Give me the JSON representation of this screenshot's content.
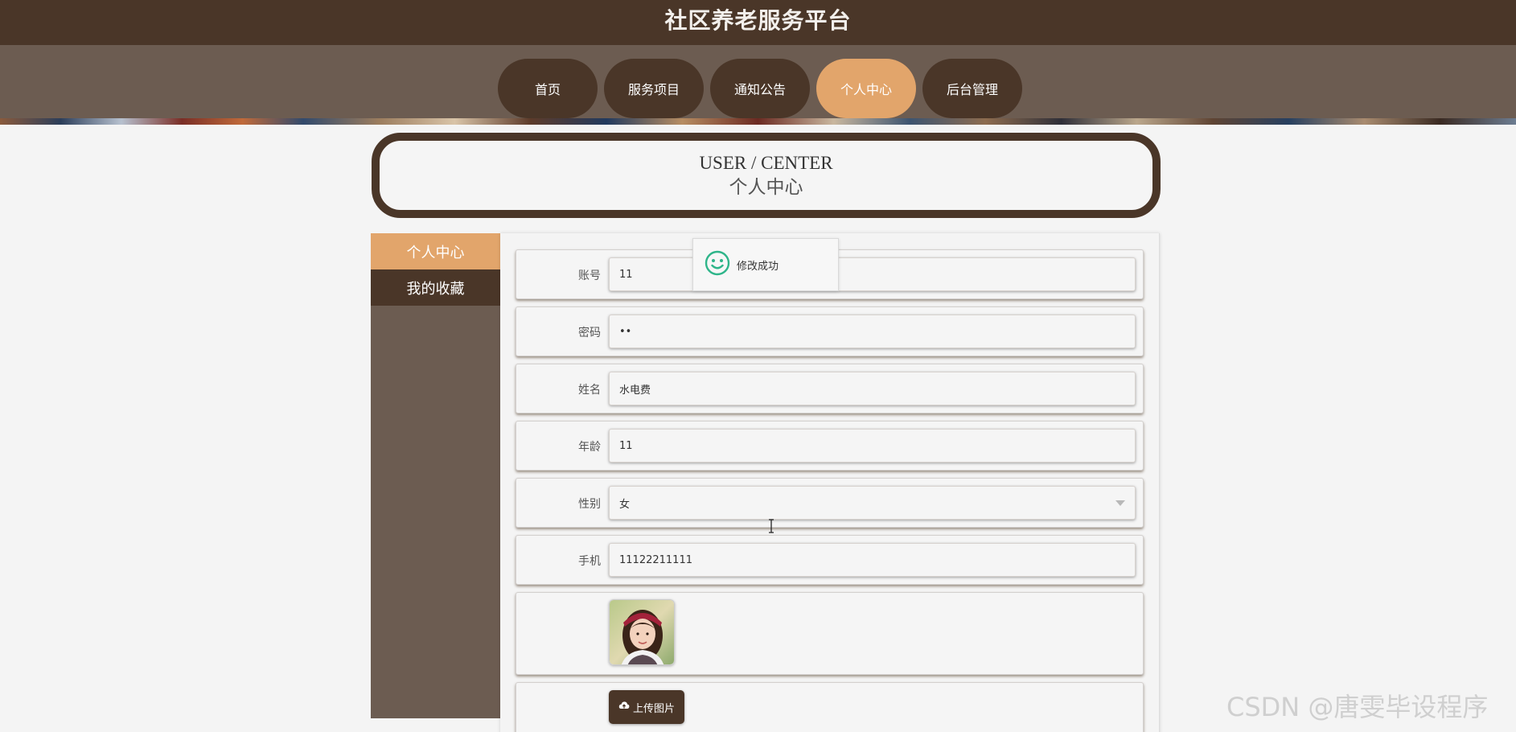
{
  "header": {
    "site_title": "社区养老服务平台"
  },
  "nav": {
    "items": [
      {
        "label": "首页",
        "active": false
      },
      {
        "label": "服务项目",
        "active": false
      },
      {
        "label": "通知公告",
        "active": false
      },
      {
        "label": "个人中心",
        "active": true
      },
      {
        "label": "后台管理",
        "active": false
      }
    ]
  },
  "page_heading": {
    "en": "USER / CENTER",
    "cn": "个人中心"
  },
  "sidebar": {
    "items": [
      {
        "label": "个人中心",
        "active": true
      },
      {
        "label": "我的收藏",
        "active": false
      }
    ]
  },
  "form": {
    "account": {
      "label": "账号",
      "value": "11"
    },
    "password": {
      "label": "密码",
      "value": "••"
    },
    "name": {
      "label": "姓名",
      "value": "水电费"
    },
    "age": {
      "label": "年龄",
      "value": "11"
    },
    "gender": {
      "label": "性别",
      "value": "女"
    },
    "phone": {
      "label": "手机",
      "value": "11122211111"
    },
    "upload_label": "上传图片"
  },
  "toast": {
    "message": "修改成功"
  },
  "watermark": "CSDN @唐雯毕设程序",
  "colors": {
    "header_bg": "#4a3628",
    "nav_bg": "#6c5c51",
    "accent": "#e2a56b",
    "toast_icon": "#2fb58a"
  },
  "icons": {
    "toast": "smile-icon",
    "upload": "cloud-upload-icon",
    "select": "chevron-down-icon"
  }
}
